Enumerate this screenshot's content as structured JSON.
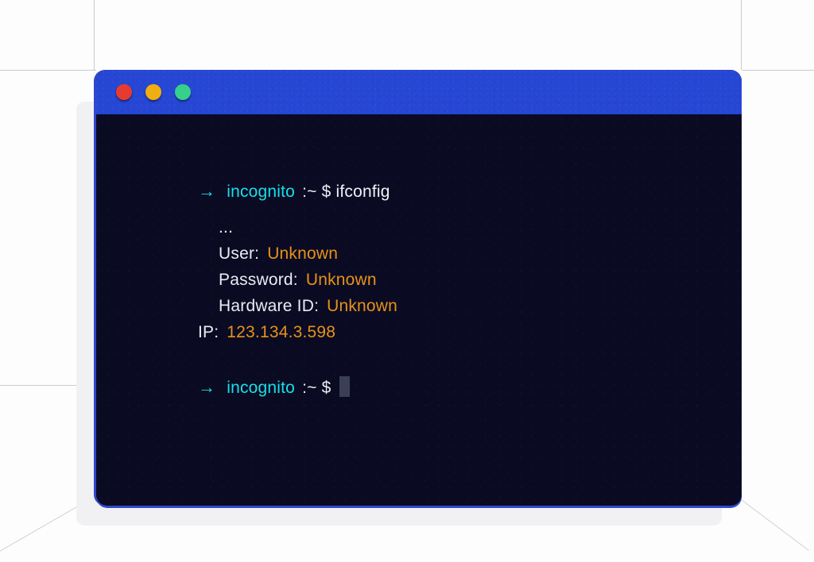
{
  "window": {
    "controls": [
      {
        "name": "close",
        "color": "#e83a2f"
      },
      {
        "name": "minimize",
        "color": "#f0ae11"
      },
      {
        "name": "zoom",
        "color": "#37cf8c"
      }
    ],
    "titlebar_color": "#2646d4",
    "body_color": "#0a0b22"
  },
  "terminal": {
    "prompt_arrow": "→",
    "host": "incognito",
    "prompt_separator": ":~ $",
    "command": "ifconfig",
    "output": {
      "ellipsis": "...",
      "rows": [
        {
          "label": "User:",
          "value": "Unknown"
        },
        {
          "label": "Password:",
          "value": "Unknown"
        },
        {
          "label": "Hardware ID:",
          "value": "Unknown"
        },
        {
          "label": "IP:",
          "value": "123.134.3.598"
        }
      ]
    },
    "cursor": "",
    "colors": {
      "host": "#18dfe9",
      "arrow": "#18dfe9",
      "text": "#e9ecf3",
      "value": "#e8911b",
      "cursor": "#3a3f55"
    }
  }
}
